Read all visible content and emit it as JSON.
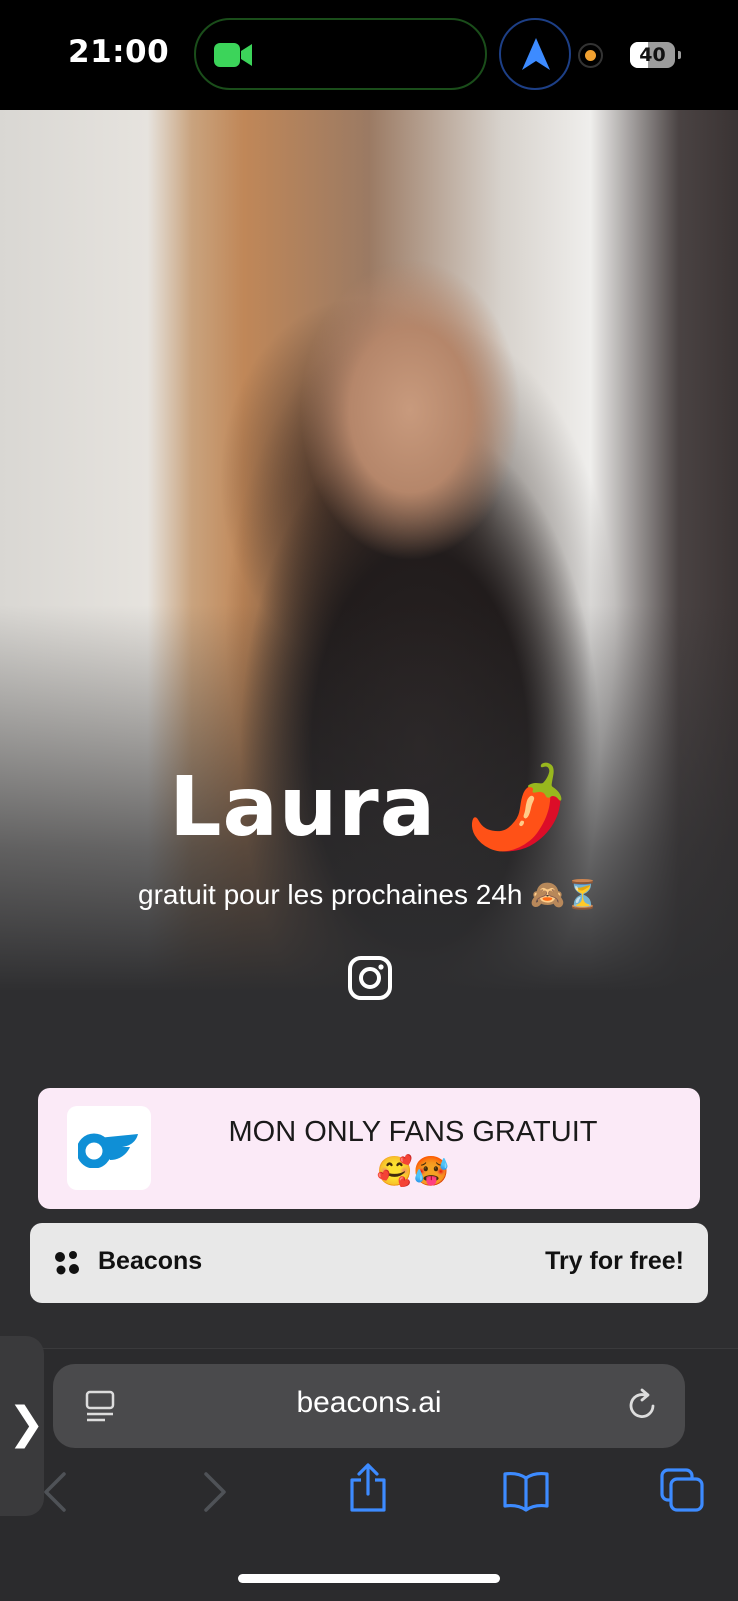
{
  "status_bar": {
    "time": "21:00",
    "battery_level": "40",
    "icons": [
      "facetime-video-icon",
      "navigation-arrow-icon",
      "recording-indicator-dot",
      "battery-icon"
    ],
    "colors": {
      "facetime_green": "#3cd45a",
      "nav_blue": "#3d8bff",
      "indicator_orange": "#f0a030"
    }
  },
  "profile": {
    "name": "Laura 🌶️",
    "subtitle": "gratuit pour les prochaines 24h 🙈⏳",
    "social_icon": "instagram-icon"
  },
  "links": [
    {
      "label_line1": "MON ONLY FANS GRATUIT",
      "label_line2": "🥰🥵",
      "icon": "onlyfans-logo-icon",
      "background": "#fbeaf7"
    }
  ],
  "beacons_bar": {
    "brand": "Beacons",
    "cta": "Try for free!"
  },
  "browser": {
    "url": "beacons.ai",
    "icons": [
      "reader-icon",
      "reload-icon",
      "back-icon",
      "forward-icon",
      "share-icon",
      "bookmarks-icon",
      "tabs-icon",
      "sidebar-chevron-icon"
    ],
    "side_tab_glyph": "❯",
    "accent": "#3d8bff"
  }
}
